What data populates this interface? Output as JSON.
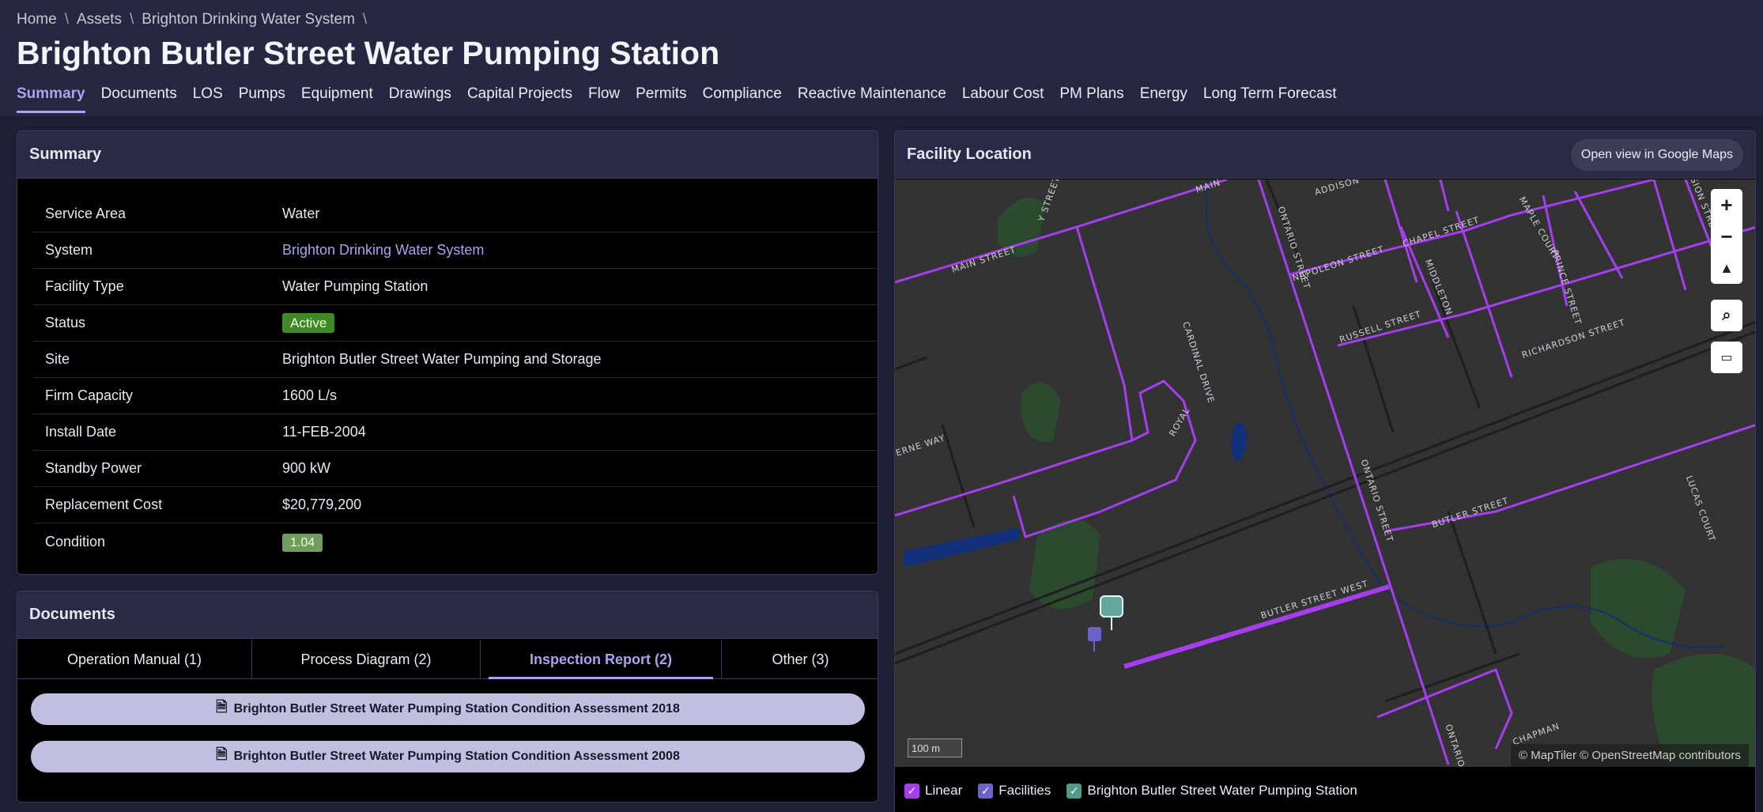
{
  "breadcrumb": [
    "Home",
    "Assets",
    "Brighton Drinking Water System"
  ],
  "breadcrumb_sep": "\\",
  "title": "Brighton Butler Street Water Pumping Station",
  "tabs": [
    "Summary",
    "Documents",
    "LOS",
    "Pumps",
    "Equipment",
    "Drawings",
    "Capital Projects",
    "Flow",
    "Permits",
    "Compliance",
    "Reactive Maintenance",
    "Labour Cost",
    "PM Plans",
    "Energy",
    "Long Term Forecast"
  ],
  "active_tab": "Summary",
  "summary": {
    "heading": "Summary",
    "rows": [
      {
        "label": "Service Area",
        "value": "Water"
      },
      {
        "label": "System",
        "value": "Brighton Drinking Water System"
      },
      {
        "label": "Facility Type",
        "value": "Water Pumping Station"
      },
      {
        "label": "Status",
        "value": "Active"
      },
      {
        "label": "Site",
        "value": "Brighton Butler Street Water Pumping and Storage"
      },
      {
        "label": "Firm Capacity",
        "value": "1600 L/s"
      },
      {
        "label": "Install Date",
        "value": "11-FEB-2004"
      },
      {
        "label": "Standby Power",
        "value": "900 kW"
      },
      {
        "label": "Replacement Cost",
        "value": "$20,779,200"
      },
      {
        "label": "Condition",
        "value": "1.04"
      }
    ]
  },
  "documents": {
    "heading": "Documents",
    "tabs": [
      "Operation Manual (1)",
      "Process Diagram (2)",
      "Inspection Report (2)",
      "Other (3)"
    ],
    "active_tab": "Inspection Report (2)",
    "items": [
      "Brighton Butler Street Water Pumping Station Condition Assessment 2018",
      "Brighton Butler Street Water Pumping Station Condition Assessment 2008"
    ]
  },
  "map": {
    "heading": "Facility Location",
    "open_button": "Open view in Google Maps",
    "scale": "100 m",
    "attribution": "© MapTiler © OpenStreetMap contributors",
    "street_labels": [
      "MAIN STREET",
      "Y STREET",
      "MAIN",
      "ADDISON",
      "ONTARIO STREET",
      "NAPOLEON STREET",
      "CHAPEL STREET",
      "MAPLE COURT",
      "DIVISION STREET NORTH",
      "PRINCE STREET",
      "RUSSELL STREET",
      "MIDDLETON",
      "RICHARDSON STREET",
      "CARDINAL DRIVE",
      "ROYAL",
      "ERNE WAY",
      "ONTARIO STREET",
      "BUTLER STREET",
      "LUCAS COURT",
      "BUTLER STREET WEST",
      "ONTARIO",
      "CHAPMAN"
    ],
    "colors": {
      "linear": "#a63ef0",
      "facility": "#6a63c8",
      "station": "#5fa89b"
    }
  },
  "legend": [
    {
      "label": "Linear",
      "color": "#a63ef0"
    },
    {
      "label": "Facilities",
      "color": "#6a63c8"
    },
    {
      "label": "Brighton Butler Street Water Pumping Station",
      "color": "#4e9b88"
    }
  ]
}
